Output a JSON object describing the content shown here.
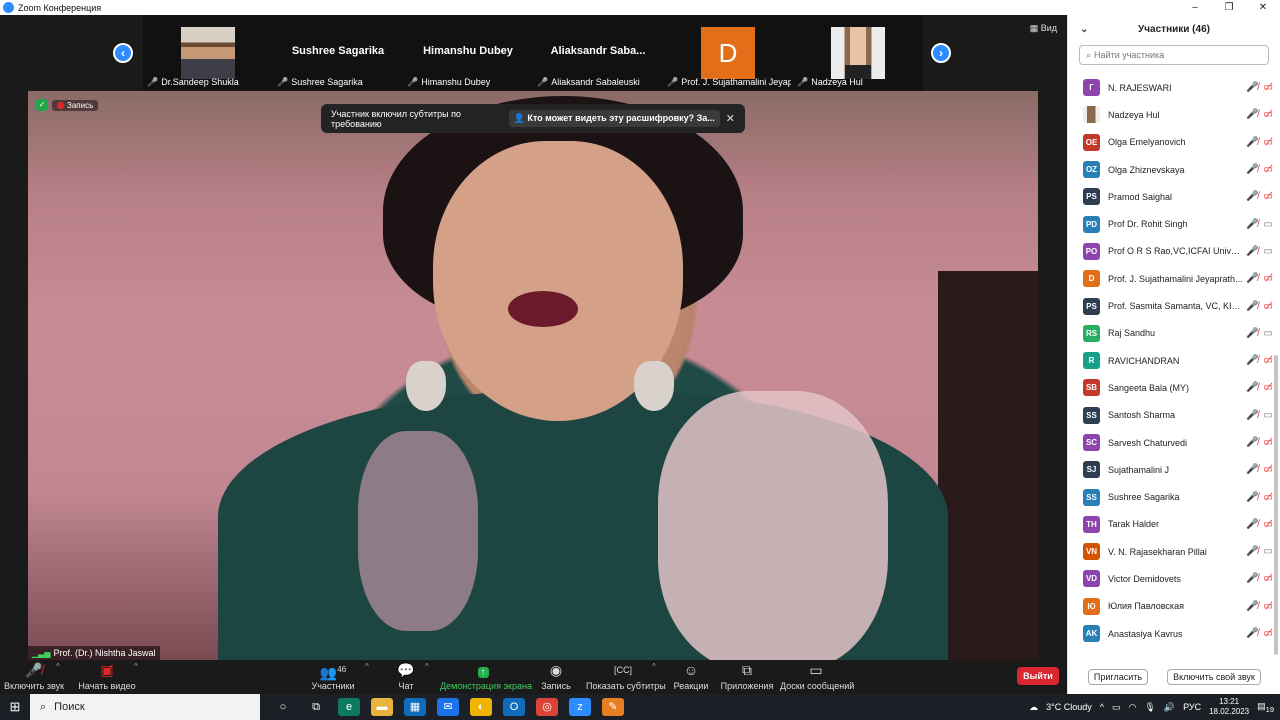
{
  "window": {
    "title": "Zoom Конференция",
    "controls": [
      "–",
      "❐",
      "✕"
    ]
  },
  "strip": {
    "view_label": "Вид",
    "thumbnails": [
      {
        "type": "photo-man",
        "name": "Dr.Sandeep Shukla"
      },
      {
        "type": "name",
        "big": "Sushree Sagarika",
        "name": "Sushree Sagarika"
      },
      {
        "type": "name",
        "big": "Himanshu Dubey",
        "name": "Himanshu Dubey"
      },
      {
        "type": "name",
        "big": "Aliaksandr  Saba...",
        "name": "Aliaksandr Sabaleuski"
      },
      {
        "type": "avatar",
        "letter": "D",
        "name": "Prof. J. Sujathamalini Jeyap..."
      },
      {
        "type": "photo-woman",
        "name": "Nadzeya Hul"
      }
    ]
  },
  "video": {
    "record_label": "Запись",
    "toast_text": "Участник включил субтитры по требованию",
    "toast_link": "Кто может видеть эту расшифровку? За...",
    "speaker": "Prof. (Dr.) Nishtha Jaswal"
  },
  "toolbar": {
    "mute": "Включить звук",
    "video": "Начать видео",
    "participants": "Участники",
    "participants_count": "46",
    "chat": "Чат",
    "share": "Демонстрация экрана",
    "record": "Запись",
    "captions": "Показать субтитры",
    "reactions": "Реакции",
    "apps": "Приложения",
    "whiteboards": "Доски сообщений",
    "leave": "Выйти"
  },
  "panel": {
    "title": "Участники (46)",
    "search_placeholder": "Найти участника",
    "participants": [
      {
        "initials": "Г",
        "color": "#8e44ad",
        "name": "N. RAJESWARI",
        "video": false
      },
      {
        "initials": "",
        "color": "photo",
        "name": "Nadzeya Hul",
        "video": false
      },
      {
        "initials": "OE",
        "color": "#c0392b",
        "name": "Olga Emelyanovich",
        "video": false
      },
      {
        "initials": "OZ",
        "color": "#2980b9",
        "name": "Olga Zhiznevskaya",
        "video": false
      },
      {
        "initials": "PS",
        "color": "#2c3e50",
        "name": "Pramod Saighal",
        "video": false
      },
      {
        "initials": "PD",
        "color": "#2980b9",
        "name": "Prof Dr. Rohit Singh",
        "video": true
      },
      {
        "initials": "PO",
        "color": "#8e44ad",
        "name": "Prof O R S Rao,VC,ICFAI Univer...",
        "video": true
      },
      {
        "initials": "D",
        "color": "#e26e1a",
        "name": "Prof. J. Sujathamalini Jeyaprath...",
        "video": false
      },
      {
        "initials": "PS",
        "color": "#2c3e50",
        "name": "Prof. Sasmita Samanta, VC, KIIT...",
        "video": false
      },
      {
        "initials": "RS",
        "color": "#27ae60",
        "name": "Raj Sandhu",
        "video": true
      },
      {
        "initials": "R",
        "color": "#16a085",
        "name": "RAVICHANDRAN",
        "video": false
      },
      {
        "initials": "SB",
        "color": "#c0392b",
        "name": "Sangeeta Bala (MY)",
        "video": false
      },
      {
        "initials": "SS",
        "color": "#2c3e50",
        "name": "Santosh Sharma",
        "video": true
      },
      {
        "initials": "SC",
        "color": "#8e44ad",
        "name": "Sarvesh Chaturvedi",
        "video": false
      },
      {
        "initials": "SJ",
        "color": "#2c3e50",
        "name": "Sujathamalini J",
        "video": false
      },
      {
        "initials": "SS",
        "color": "#2980b9",
        "name": "Sushree Sagarika",
        "video": false
      },
      {
        "initials": "TH",
        "color": "#8e44ad",
        "name": "Tarak Halder",
        "video": false
      },
      {
        "initials": "VN",
        "color": "#d35400",
        "name": "V. N. Rajasekharan Pillai",
        "video": true
      },
      {
        "initials": "VD",
        "color": "#8e44ad",
        "name": "Victor Demidovets",
        "video": false
      },
      {
        "initials": "Ю",
        "color": "#e26e1a",
        "name": "Юлия Павловская",
        "video": false
      },
      {
        "initials": "AK",
        "color": "#2980b9",
        "name": "Anastasiya Kavrus",
        "video": false
      }
    ],
    "invite": "Пригласить",
    "unmute_self": "Включить свой звук"
  },
  "taskbar": {
    "search": "Поиск",
    "weather": "3°C  Cloudy",
    "lang": "РУС",
    "time": "13:21",
    "date": "18.02.2023",
    "notifications": "19"
  }
}
